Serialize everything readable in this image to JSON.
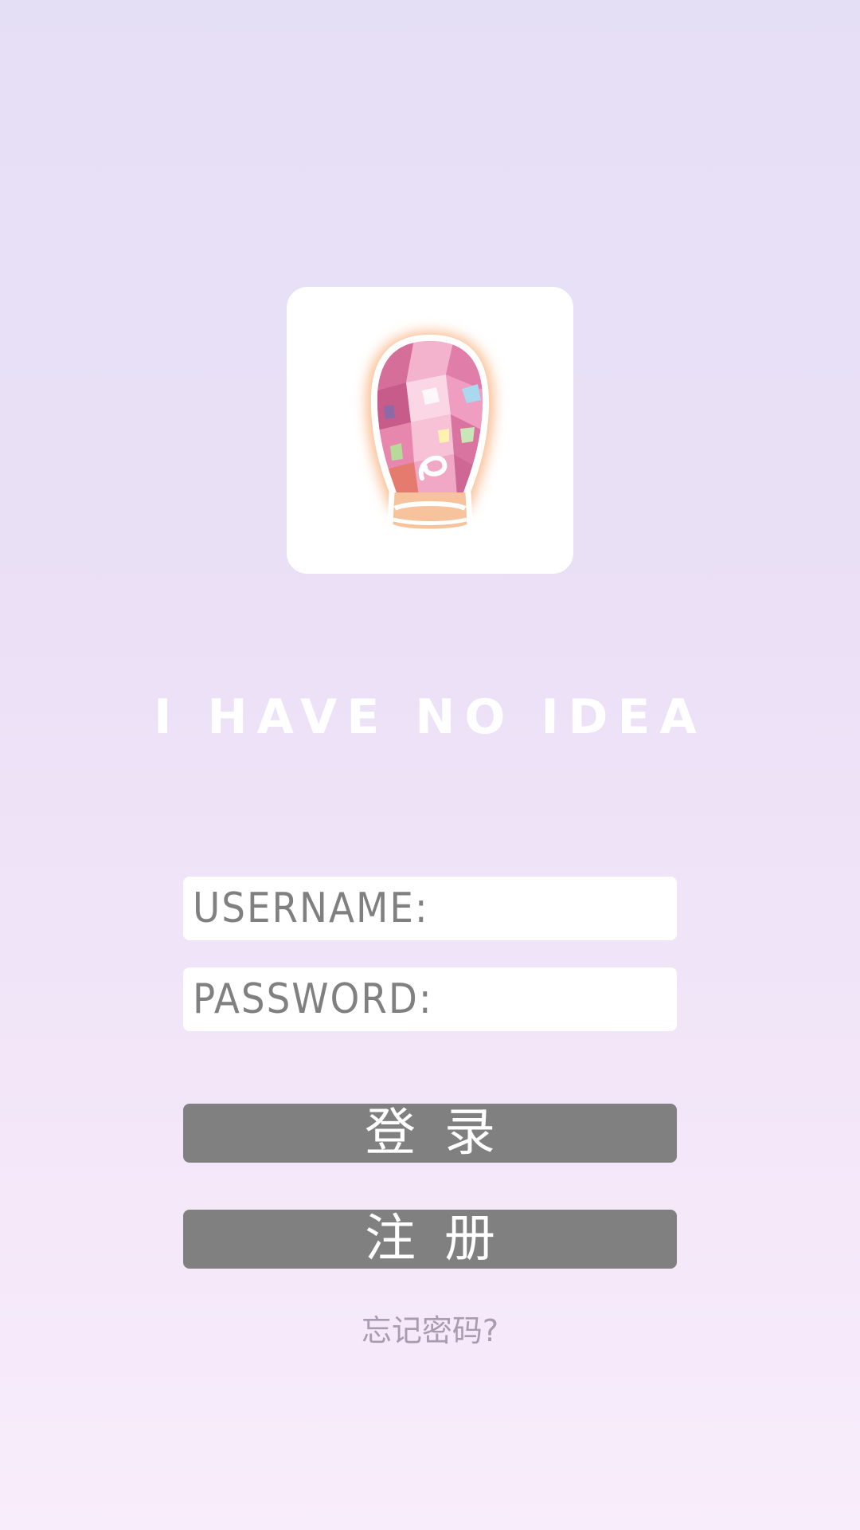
{
  "logo": {
    "icon": "hot-air-lantern-mosaic-icon",
    "colors": {
      "card": "#ffffff",
      "glow": "#f7a66b",
      "lantern_pink": "#e98fb4",
      "outline": "#ffffff"
    }
  },
  "brand": {
    "title": "I HAVE NO IDEA"
  },
  "form": {
    "username_label": "USERNAME:",
    "username_value": "",
    "password_label": "PASSWORD:",
    "password_value": ""
  },
  "buttons": {
    "login_label": "登录",
    "register_label": "注册",
    "button_color": "#808080"
  },
  "links": {
    "forgot_password": "忘记密码?"
  },
  "theme": {
    "background_top": "#e5dff5",
    "background_bottom": "#f8edfa",
    "forgot_link_color": "#a99bb0"
  }
}
